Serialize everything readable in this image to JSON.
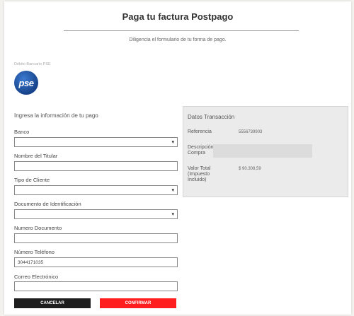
{
  "page": {
    "title": "Paga tu factura Postpago",
    "subtitle": "Diligencia el formulario de tu forma de pago."
  },
  "payment_method": {
    "label": "Débito Bancario PSE",
    "logo_text": "pse"
  },
  "form": {
    "heading": "Ingresa la información de tu pago",
    "banco_label": "Banco",
    "banco_value": "",
    "titular_label": "Nombre del Titular",
    "titular_value": "",
    "tipo_cliente_label": "Tipo de Cliente",
    "tipo_cliente_value": "",
    "documento_id_label": "Documento de Identificación",
    "documento_id_value": "",
    "numero_documento_label": "Numero Documento",
    "numero_documento_value": "",
    "telefono_label": "Número Teléfono",
    "telefono_value": "3044171035",
    "correo_label": "Correo Electrónico",
    "correo_value": ""
  },
  "buttons": {
    "cancel": "CANCELAR",
    "confirm": "CONFIRMAR"
  },
  "transaction": {
    "title": "Datos Transacción",
    "referencia_label": "Referencia",
    "referencia_value": "5556739903",
    "descripcion_label": "Descripción Compra",
    "valor_label": "Valor Total (Impuesto Incluido)",
    "valor_value": "$ 90.308,59"
  },
  "icons": {
    "select_caret": "▾"
  },
  "colors": {
    "confirm_button": "#ff1e1e",
    "cancel_button": "#1e1e1e",
    "pse_logo": "#1f5aa8"
  }
}
